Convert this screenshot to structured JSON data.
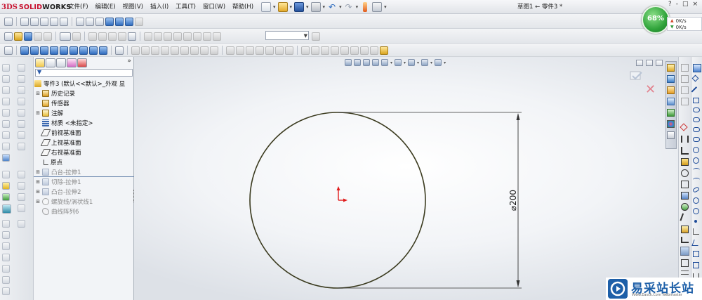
{
  "app": {
    "brand_prefix": "3DS",
    "brand_solid": "SOLID",
    "brand_works": "WORKS"
  },
  "menu": {
    "items": [
      "文件(F)",
      "编辑(E)",
      "视图(V)",
      "插入(I)",
      "工具(T)",
      "窗口(W)",
      "帮助(H)"
    ]
  },
  "window": {
    "document_title": "草图1 ← 零件3 *",
    "controls": [
      "?",
      "-",
      "□",
      "×"
    ]
  },
  "feature_tree": {
    "expand_label": "»",
    "root": "零件3 (默认<<默认>_外观 显",
    "nodes": [
      {
        "label": "历史记录",
        "exp": "⊞"
      },
      {
        "label": "传感器",
        "exp": ""
      },
      {
        "label": "注解",
        "exp": "⊞"
      },
      {
        "label": "材质 <未指定>",
        "exp": ""
      },
      {
        "label": "前视基准面",
        "exp": ""
      },
      {
        "label": "上视基准面",
        "exp": ""
      },
      {
        "label": "右视基准面",
        "exp": ""
      },
      {
        "label": "原点",
        "exp": ""
      },
      {
        "label": "凸台-拉伸1",
        "exp": "⊞"
      },
      {
        "label": "切除-拉伸1",
        "exp": "⊞"
      },
      {
        "label": "凸台-拉伸2",
        "exp": "⊞"
      },
      {
        "label": "螺旋线/涡状线1",
        "exp": "⊞"
      },
      {
        "label": "曲线阵列6",
        "exp": ""
      }
    ]
  },
  "sketch": {
    "dimension_label": "⌀200"
  },
  "status": {
    "cpu_percent_label": "68%",
    "upload": "0K/s",
    "download": "0K/s"
  },
  "colors": {
    "circle": "#3a3a1e",
    "origin": "#e01b1b",
    "accent": "#2f6cbf",
    "perf_green": "#2fa33a"
  },
  "watermark": {
    "name": "易采站长站",
    "sub": "Www.Easck.Com Webmaster"
  }
}
